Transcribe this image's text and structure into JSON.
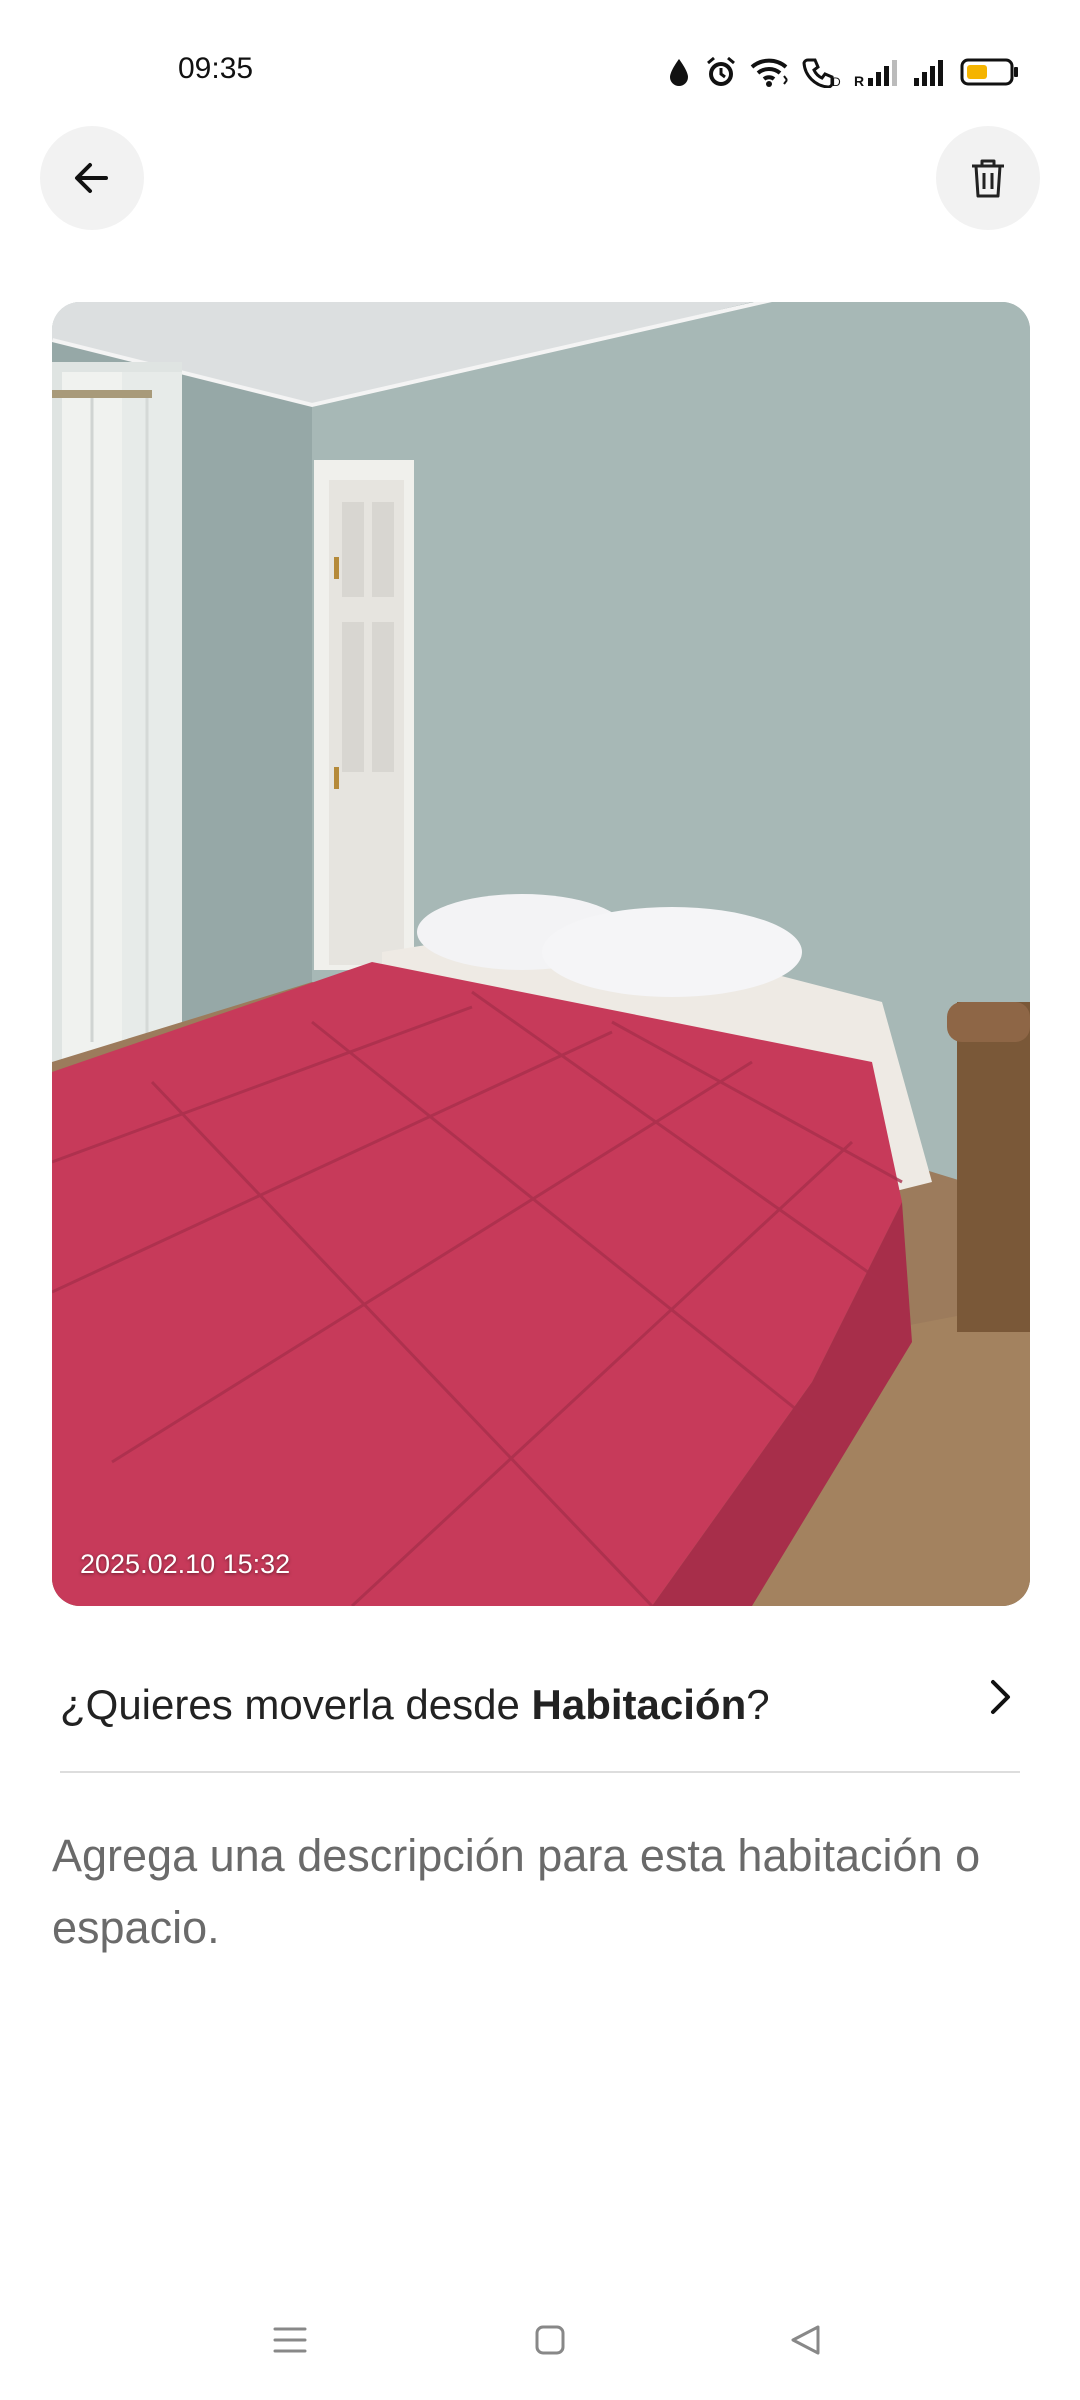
{
  "status_bar": {
    "time": "09:35",
    "icons": [
      "data-saver-icon",
      "alarm-icon",
      "wifi-icon",
      "volte-call-icon",
      "signal-roaming-icon",
      "signal-icon",
      "battery-low-icon"
    ],
    "battery_color": "#f5b400"
  },
  "header": {
    "back_icon": "arrow-left-icon",
    "delete_icon": "trash-icon"
  },
  "photo": {
    "timestamp": "2025.02.10 15:32",
    "description": "bedroom-photo"
  },
  "move": {
    "prefix": "¿Quieres moverla desde ",
    "room": "Habitación",
    "suffix": "?",
    "icon": "chevron-right-icon"
  },
  "description_field": {
    "placeholder": "Agrega una descripción para esta habitación o espacio."
  },
  "nav": {
    "icons": [
      "menu-icon",
      "home-square-icon",
      "back-triangle-icon"
    ]
  }
}
